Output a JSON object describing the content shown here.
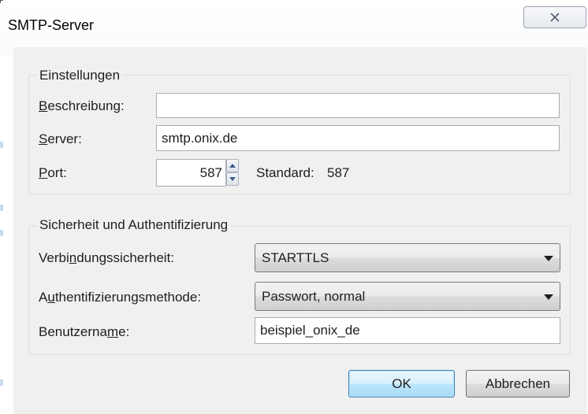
{
  "window": {
    "title": "SMTP-Server",
    "close_icon": "close-x-icon"
  },
  "settings": {
    "legend": "Einstellungen",
    "description_label_accel": "B",
    "description_label_rest": "eschreibung:",
    "description_value": "",
    "server_label_accel": "S",
    "server_label_rest": "erver:",
    "server_value": "smtp.onix.de",
    "port_label_accel": "P",
    "port_label_rest": "ort:",
    "port_value": "587",
    "standard_label": "Standard:",
    "standard_value": "587"
  },
  "security": {
    "legend": "Sicherheit und Authentifizierung",
    "connection_label_pre": "Verbi",
    "connection_label_accel": "n",
    "connection_label_post": "dungssicherheit:",
    "connection_value": "STARTTLS",
    "auth_label_pre": "A",
    "auth_label_accel": "u",
    "auth_label_post": "thentifizierungsmethode:",
    "auth_value": "Passwort, normal",
    "username_label_pre": "Benutzerna",
    "username_label_accel": "m",
    "username_label_post": "e:",
    "username_value": "beispiel_onix_de"
  },
  "buttons": {
    "ok": "OK",
    "cancel": "Abbrechen"
  }
}
